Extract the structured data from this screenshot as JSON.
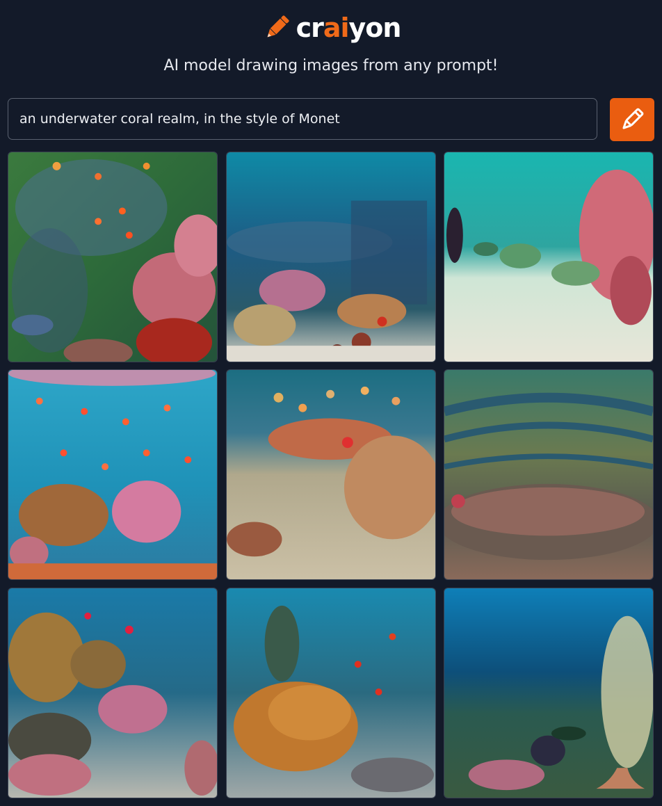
{
  "header": {
    "logo_prefix": "cr",
    "logo_accent": "ai",
    "logo_suffix": "yon",
    "tagline": "AI model drawing images from any prompt!",
    "logo_icon": "pencil-icon"
  },
  "prompt": {
    "value": "an underwater coral realm, in the style of Monet",
    "button_icon": "pencil-icon"
  },
  "colors": {
    "background": "#131a29",
    "accent": "#ea5d10",
    "text": "#ffffff"
  },
  "results": {
    "images": [
      {
        "icon": "generated-image"
      },
      {
        "icon": "generated-image"
      },
      {
        "icon": "generated-image"
      },
      {
        "icon": "generated-image"
      },
      {
        "icon": "generated-image"
      },
      {
        "icon": "generated-image"
      },
      {
        "icon": "generated-image"
      },
      {
        "icon": "generated-image"
      },
      {
        "icon": "generated-image"
      }
    ]
  }
}
